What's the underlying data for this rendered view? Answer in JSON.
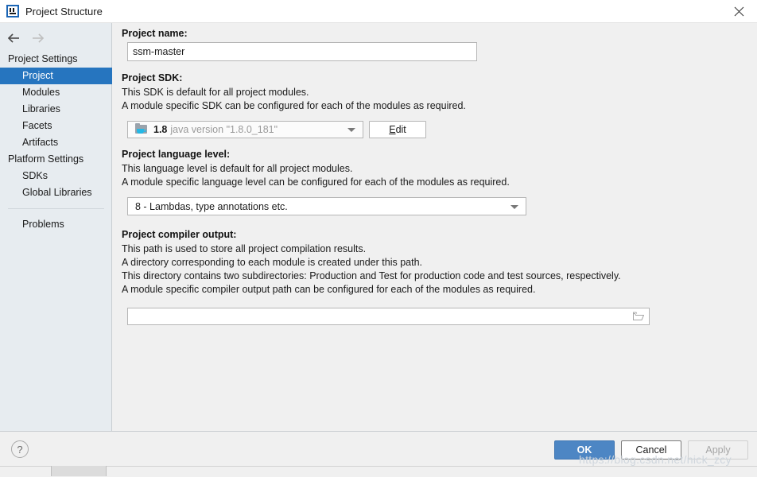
{
  "window": {
    "title": "Project Structure",
    "app_icon": "intellij-idea-icon",
    "close_label": "✕"
  },
  "nav": {
    "back_icon": "arrow-left-icon",
    "forward_icon": "arrow-right-icon"
  },
  "sidebar": {
    "groups": [
      {
        "label": "Project Settings",
        "items": [
          {
            "label": "Project",
            "selected": true
          },
          {
            "label": "Modules",
            "selected": false
          },
          {
            "label": "Libraries",
            "selected": false
          },
          {
            "label": "Facets",
            "selected": false
          },
          {
            "label": "Artifacts",
            "selected": false
          }
        ]
      },
      {
        "label": "Platform Settings",
        "items": [
          {
            "label": "SDKs",
            "selected": false
          },
          {
            "label": "Global Libraries",
            "selected": false
          }
        ]
      }
    ],
    "problems": {
      "label": "Problems"
    },
    "selection_color": "#2675bf",
    "background_color": "#e7ecf0"
  },
  "main": {
    "project_name": {
      "label": "Project name:",
      "value": "ssm-master",
      "placeholder": ""
    },
    "project_sdk": {
      "label": "Project SDK:",
      "description": [
        "This SDK is default for all project modules.",
        "A module specific SDK can be configured for each of the modules as required."
      ],
      "selected_version": "1.8",
      "selected_detail": "java version \"1.8.0_181\"",
      "icon": "java-sdk-folder-icon",
      "edit_button": {
        "label_prefix": "",
        "mnemonic": "E",
        "label_suffix": "dit"
      }
    },
    "language_level": {
      "label": "Project language level:",
      "description": [
        "This language level is default for all project modules.",
        "A module specific language level can be configured for each of the modules as required."
      ],
      "selected": "8 - Lambdas, type annotations etc."
    },
    "compiler_output": {
      "label": "Project compiler output:",
      "description": [
        "This path is used to store all project compilation results.",
        "A directory corresponding to each module is created under this path.",
        "This directory contains two subdirectories: Production and Test for production code and test sources, respectively.",
        "A module specific compiler output path can be configured for each of the modules as required."
      ],
      "value": "",
      "placeholder": "",
      "browse_icon": "folder-open-icon"
    }
  },
  "footer": {
    "help_label": "?",
    "ok_label": "OK",
    "cancel_label": "Cancel",
    "apply_label": "Apply",
    "ok_color": "#4d86c4"
  },
  "watermark": {
    "text": "https://blog.csdn.net/nick_zcy"
  }
}
